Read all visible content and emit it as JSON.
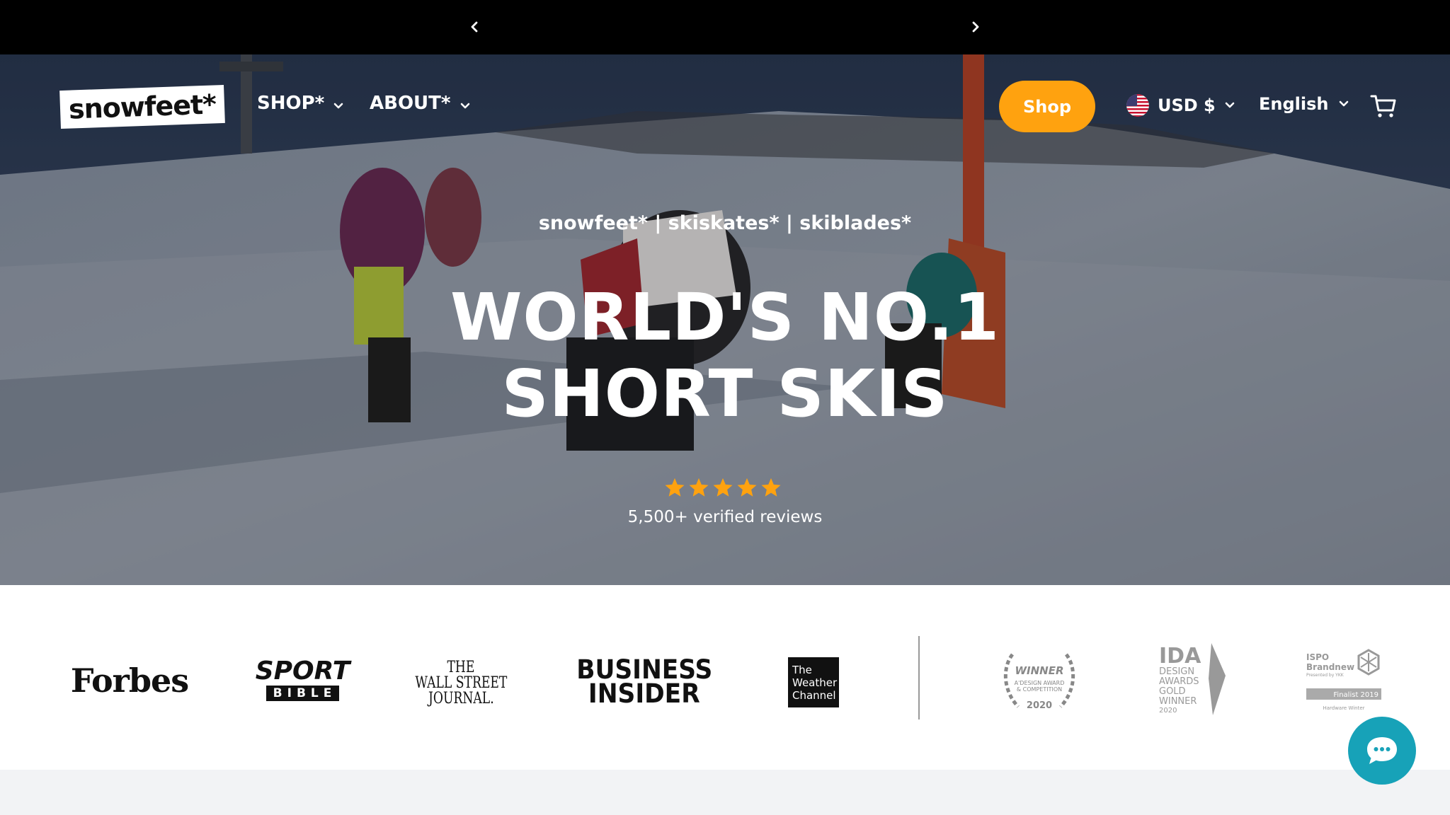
{
  "announcement": {
    "prev_label": "",
    "next_label": ""
  },
  "nav": {
    "logo_text": "snowfeet*",
    "menu": [
      {
        "label": "SHOP*"
      },
      {
        "label": "ABOUT*"
      }
    ],
    "shop_button": "Shop",
    "currency": "USD $",
    "language": "English"
  },
  "hero": {
    "subtitle": "snowfeet* | skiskates* | skiblades*",
    "title_line1": "WORLD'S NO.1",
    "title_line2": "SHORT SKIS",
    "rating_stars": 5,
    "reviews": "5,500+ verified reviews"
  },
  "press": {
    "logos": [
      {
        "name": "Forbes",
        "text": "Forbes"
      },
      {
        "name": "Sport Bible",
        "text_top": "SPORT",
        "text_bottom": "BIBLE"
      },
      {
        "name": "The Wall Street Journal",
        "lines": [
          "THE",
          "WALL STREET",
          "JOURNAL."
        ]
      },
      {
        "name": "Business Insider",
        "lines": [
          "BUSINESS",
          "INSIDER"
        ]
      },
      {
        "name": "The Weather Channel",
        "lines": [
          "The",
          "Weather",
          "Channel"
        ]
      }
    ],
    "awards": [
      {
        "lines": [
          "WINNER",
          "A'DESIGN AWARD",
          "& COMPETITION",
          "2020"
        ]
      },
      {
        "lines": [
          "IDA",
          "DESIGN",
          "AWARDS",
          "GOLD",
          "WINNER",
          "2020"
        ]
      },
      {
        "lines": [
          "ISPO",
          "Brandnew",
          "Presented by YKK",
          "Finalist 2019",
          "Hardware Winter"
        ]
      }
    ]
  },
  "colors": {
    "accent": "#ffa20f",
    "chat": "#17a2b8",
    "topbar": "#000000"
  },
  "icons": [
    "chevron-left-icon",
    "chevron-right-icon",
    "chevron-down-icon",
    "us-flag-icon",
    "cart-icon",
    "star-icon",
    "chat-icon"
  ]
}
